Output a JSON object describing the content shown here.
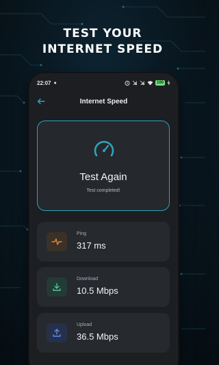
{
  "promo": {
    "line1": "TEST YOUR",
    "line2": "INTERNET SPEED"
  },
  "status_bar": {
    "time": "22:07",
    "battery": "100"
  },
  "header": {
    "title": "Internet Speed"
  },
  "test_card": {
    "label": "Test Again",
    "status": "Test completed!"
  },
  "metrics": [
    {
      "name": "Ping",
      "value": "317 ms",
      "icon": "pulse-icon"
    },
    {
      "name": "Download",
      "value": "10.5 Mbps",
      "icon": "download-icon"
    },
    {
      "name": "Upload",
      "value": "36.5 Mbps",
      "icon": "upload-icon"
    }
  ],
  "colors": {
    "accent": "#2ba6b9",
    "ping_icon": "#e08a3c",
    "download_icon": "#4fc79a",
    "upload_icon": "#5a8cf0",
    "background": "#0a1a24"
  }
}
